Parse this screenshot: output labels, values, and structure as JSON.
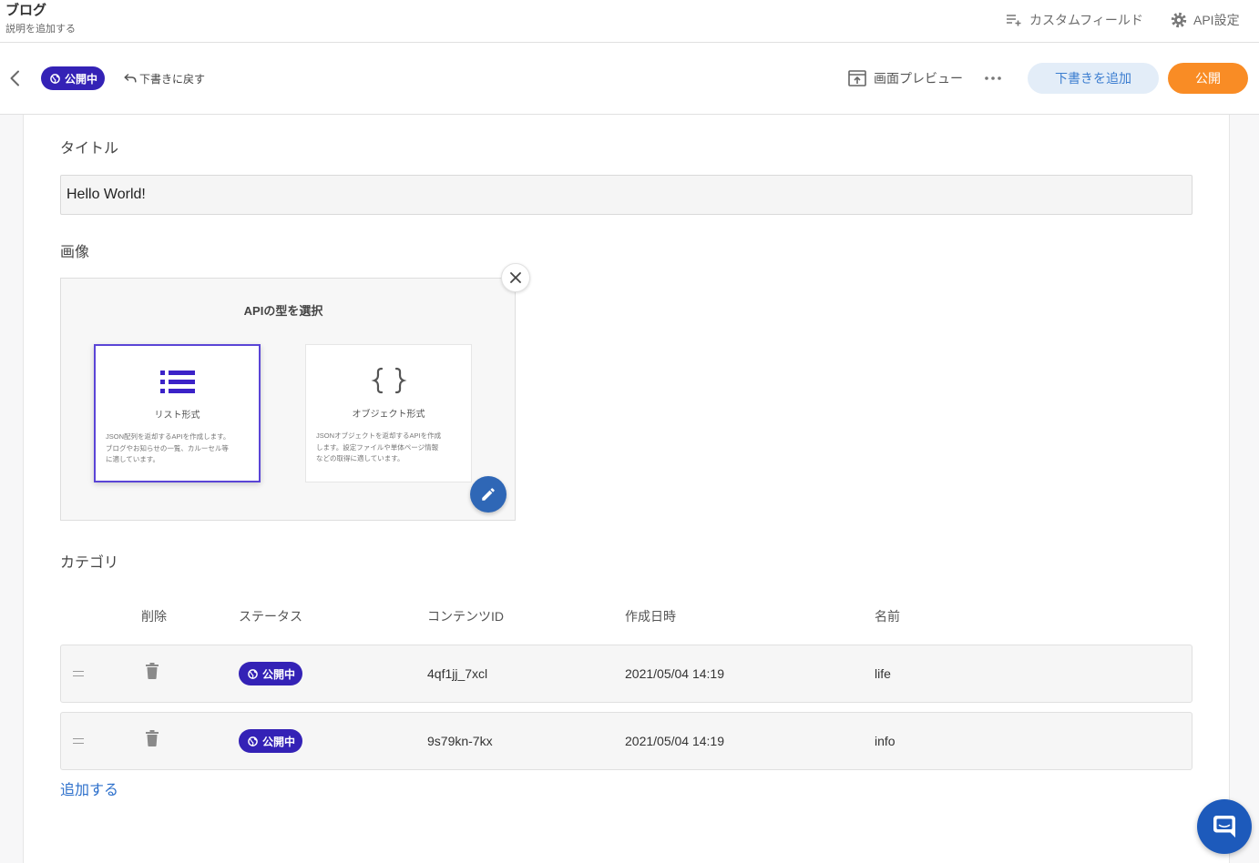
{
  "header": {
    "title": "ブログ",
    "description": "説明を追加する",
    "custom_field_label": "カスタムフィールド",
    "api_settings_label": "API設定"
  },
  "toolbar": {
    "status_badge": "公開中",
    "revert_label": "下書きに戻す",
    "preview_label": "画面プレビュー",
    "add_draft_label": "下書きを追加",
    "publish_label": "公開"
  },
  "form": {
    "title_field": {
      "label": "タイトル",
      "value": "Hello World!"
    },
    "image_field": {
      "label": "画像",
      "image": {
        "heading": "APIの型を選択",
        "options": [
          {
            "name": "リスト形式",
            "icon": "list-icon",
            "selected": true,
            "description": [
              "JSON配列を返却するAPIを作成します。",
              "ブログやお知らせの一覧、カルーセル等",
              "に適しています。"
            ]
          },
          {
            "name": "オブジェクト形式",
            "icon": "braces-icon",
            "selected": false,
            "description": [
              "JSONオブジェクトを返却するAPIを作成",
              "します。設定ファイルや単体ページ情報",
              "などの取得に適しています。"
            ]
          }
        ]
      }
    },
    "category_field": {
      "label": "カテゴリ",
      "columns": [
        "削除",
        "ステータス",
        "コンテンツID",
        "作成日時",
        "名前"
      ],
      "rows": [
        {
          "status": "公開中",
          "content_id": "4qf1jj_7xcl",
          "created_at": "2021/05/04 14:19",
          "name": "life"
        },
        {
          "status": "公開中",
          "content_id": "9s79kn-7kx",
          "created_at": "2021/05/04 14:19",
          "name": "info"
        }
      ],
      "add_label": "追加する"
    }
  },
  "icons": {
    "back": "chevron-left-icon",
    "custom_field": "playlist-add-icon",
    "api_settings": "gear-icon",
    "status": "globe-icon",
    "revert": "undo-icon",
    "preview": "open-preview-icon",
    "more": "more-horizontal-icon",
    "remove_image": "close-icon",
    "edit_image": "pencil-icon",
    "row_drag": "drag-handle-icon",
    "row_delete": "trash-icon",
    "chat": "chat-icon"
  },
  "colors": {
    "status": "#3422b6",
    "publish": "#f98c25",
    "draft_bg": "#e3edf8",
    "draft_text": "#3b7dd0",
    "link": "#2c6fcb",
    "chat": "#1d5abb",
    "edit": "#2f67b6",
    "selected": "#5a45d6",
    "list_icon": "#3b22c8"
  }
}
